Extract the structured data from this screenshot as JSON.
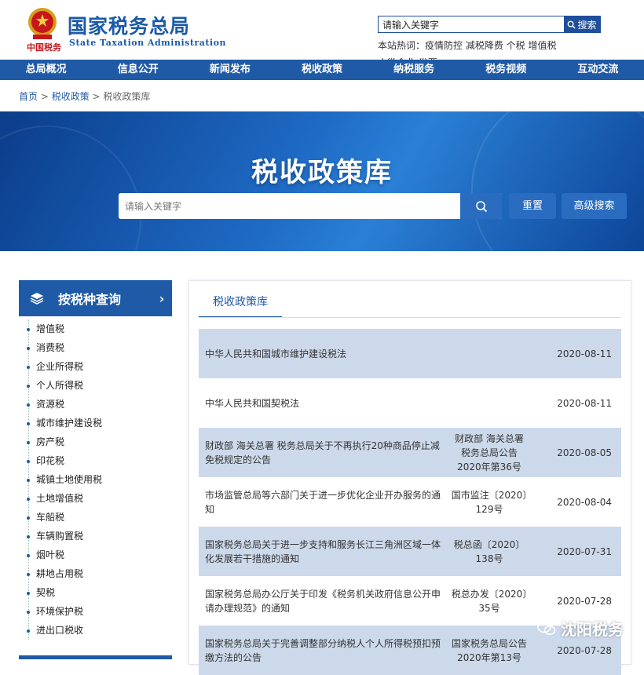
{
  "header": {
    "logo_script": "中国税务",
    "site_name_cn": "国家税务总局",
    "site_name_en": "State Taxation Administration",
    "search_placeholder": "请输入关键字",
    "search_button": "搜索",
    "hot_words": "本站热词：疫情防控 减税降费 个税 增值税 小微企业 发票"
  },
  "nav": {
    "items": [
      "总局概况",
      "信息公开",
      "新闻发布",
      "税收政策",
      "纳税服务",
      "税务视频",
      "互动交流"
    ]
  },
  "breadcrumb": {
    "home": "首页",
    "sep1": " > ",
    "level1": "税收政策",
    "sep2": " > ",
    "current": "税收政策库"
  },
  "banner": {
    "title": "税收政策库",
    "search_placeholder": "请输入关键字",
    "reset": "重置",
    "advanced": "高级搜索"
  },
  "sidebar": {
    "title": "按税种查询",
    "items": [
      "增值税",
      "消费税",
      "企业所得税",
      "个人所得税",
      "资源税",
      "城市维护建设税",
      "房产税",
      "印花税",
      "城镇土地使用税",
      "土地增值税",
      "车船税",
      "车辆购置税",
      "烟叶税",
      "耕地占用税",
      "契税",
      "环境保护税",
      "进出口税收"
    ]
  },
  "main": {
    "tab": "税收政策库",
    "rows": [
      {
        "title": "中华人民共和国城市维护建设税法",
        "docno": "",
        "date": "2020-08-11"
      },
      {
        "title": "中华人民共和国契税法",
        "docno": "",
        "date": "2020-08-11"
      },
      {
        "title": "财政部 海关总署 税务总局关于不再执行20种商品停止减免税规定的公告",
        "docno": "财政部 海关总署 税务总局公告2020年第36号",
        "date": "2020-08-05"
      },
      {
        "title": "市场监管总局等六部门关于进一步优化企业开办服务的通知",
        "docno": "国市监注〔2020〕129号",
        "date": "2020-08-04"
      },
      {
        "title": "国家税务总局关于进一步支持和服务长江三角洲区域一体化发展若干措施的通知",
        "docno": "税总函〔2020〕138号",
        "date": "2020-07-31"
      },
      {
        "title": "国家税务总局办公厅关于印发《税务机关政府信息公开申请办理规范》的通知",
        "docno": "税总办发〔2020〕35号",
        "date": "2020-07-28"
      },
      {
        "title": "国家税务总局关于完善调整部分纳税人个人所得税预扣预缴方法的公告",
        "docno": "国家税务总局公告2020年第13号",
        "date": "2020-07-28"
      }
    ]
  },
  "watermark": "沈阳税务",
  "colors": {
    "brand_blue": "#1f5aa6",
    "logo_red": "#c8161d",
    "row_alt": "#ccd9ea"
  }
}
